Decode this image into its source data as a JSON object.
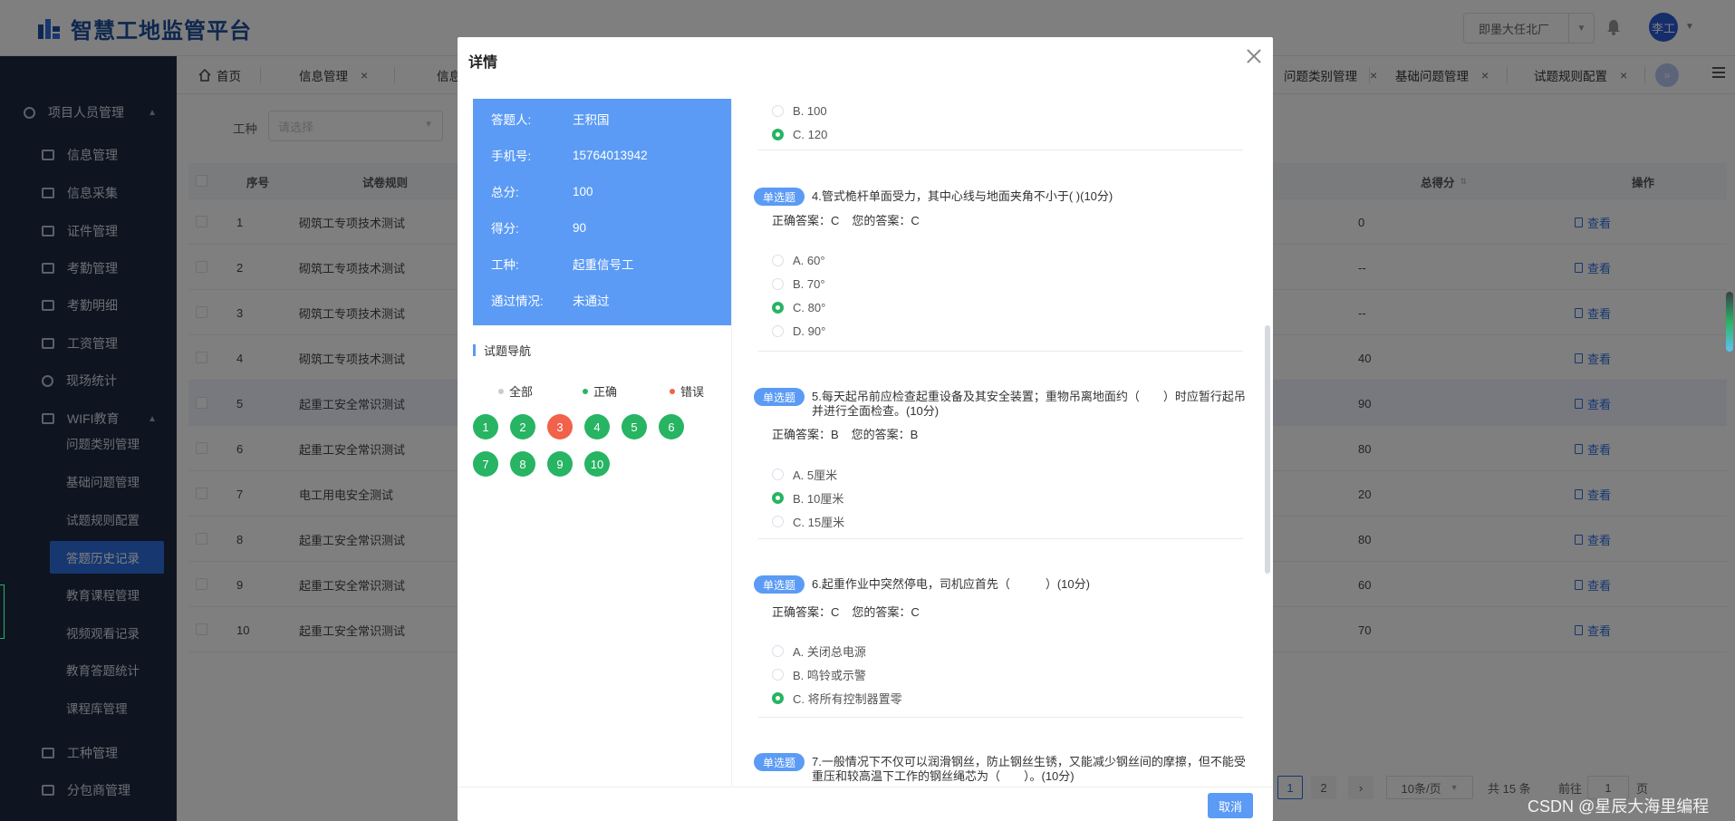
{
  "app": {
    "title": "智慧工地监管平台",
    "factory_select": "即墨大任北厂",
    "user_avatar": "李工",
    "watermark": "CSDN @星辰大海里编程"
  },
  "sidebar": {
    "groups": [
      {
        "label": "项目人员管理",
        "expanded": true
      },
      {
        "label": "WIFI教育",
        "expanded": true
      }
    ],
    "items_top": [
      "信息管理",
      "信息采集",
      "证件管理",
      "考勤管理",
      "考勤明细",
      "工资管理",
      "现场统计"
    ],
    "wifi_sub": [
      "问题类别管理",
      "基础问题管理",
      "试题规则配置",
      "答题历史记录",
      "教育课程管理",
      "视频观看记录",
      "教育答题统计",
      "课程库管理"
    ],
    "active": "答题历史记录",
    "items_bottom": [
      "工种管理",
      "分包商管理"
    ]
  },
  "tabs": {
    "home": "首页",
    "items": [
      "信息管理",
      "信息",
      "问题类别管理",
      "基础问题管理",
      "试题规则配置"
    ],
    "more_icon": "»"
  },
  "filter": {
    "label": "工种",
    "placeholder": "请选择"
  },
  "table": {
    "headers": {
      "seq": "序号",
      "rule": "试卷规则",
      "total": "总得分",
      "op": "操作"
    },
    "rows": [
      {
        "seq": "1",
        "rule": "砌筑工专项技术测试",
        "score": "0"
      },
      {
        "seq": "2",
        "rule": "砌筑工专项技术测试",
        "score": "--"
      },
      {
        "seq": "3",
        "rule": "砌筑工专项技术测试",
        "score": "--"
      },
      {
        "seq": "4",
        "rule": "砌筑工专项技术测试",
        "score": "40"
      },
      {
        "seq": "5",
        "rule": "起重工安全常识测试",
        "score": "90"
      },
      {
        "seq": "6",
        "rule": "起重工安全常识测试",
        "score": "80"
      },
      {
        "seq": "7",
        "rule": "电工用电安全测试",
        "score": "20"
      },
      {
        "seq": "8",
        "rule": "起重工安全常识测试",
        "score": "80"
      },
      {
        "seq": "9",
        "rule": "起重工安全常识测试",
        "score": "60"
      },
      {
        "seq": "10",
        "rule": "起重工安全常识测试",
        "score": "70"
      }
    ],
    "view_label": "查看"
  },
  "pagination": {
    "pages": [
      "1",
      "2"
    ],
    "current": "1",
    "next": "›",
    "size": "10条/页",
    "total": "共 15 条",
    "goto": "前往",
    "goto_value": "1",
    "page_unit": "页"
  },
  "modal": {
    "title": "详情",
    "info": [
      {
        "k": "答题人:",
        "v": "王积国"
      },
      {
        "k": "手机号:",
        "v": "15764013942"
      },
      {
        "k": "总分:",
        "v": "100"
      },
      {
        "k": "得分:",
        "v": "90"
      },
      {
        "k": "工种:",
        "v": "起重信号工"
      },
      {
        "k": "通过情况:",
        "v": "未通过"
      }
    ],
    "nav_title": "试题导航",
    "legend": {
      "all": "全部",
      "correct": "正确",
      "wrong": "错误"
    },
    "question_numbers": [
      {
        "n": "1",
        "ok": true
      },
      {
        "n": "2",
        "ok": true
      },
      {
        "n": "3",
        "ok": false
      },
      {
        "n": "4",
        "ok": true
      },
      {
        "n": "5",
        "ok": true
      },
      {
        "n": "6",
        "ok": true
      },
      {
        "n": "7",
        "ok": true
      },
      {
        "n": "8",
        "ok": true
      },
      {
        "n": "9",
        "ok": true
      },
      {
        "n": "10",
        "ok": true
      }
    ],
    "prev_options": [
      {
        "label": "B. 100",
        "selected": false
      },
      {
        "label": "C. 120",
        "selected": true
      }
    ],
    "questions": [
      {
        "tag": "单选题",
        "text": "4.管式桅杆单面受力，其中心线与地面夹角不小于( )(10分)",
        "correct": "正确答案：C",
        "mine": "您的答案：C",
        "options": [
          {
            "label": "A. 60°",
            "selected": false
          },
          {
            "label": "B. 70°",
            "selected": false
          },
          {
            "label": "C. 80°",
            "selected": true
          },
          {
            "label": "D. 90°",
            "selected": false
          }
        ]
      },
      {
        "tag": "单选题",
        "text": "5.每天起吊前应检查起重设备及其安全装置；重物吊离地面约（　　）时应暂行起吊并进行全面检查。(10分)",
        "correct": "正确答案：B",
        "mine": "您的答案：B",
        "options": [
          {
            "label": "A. 5厘米",
            "selected": false
          },
          {
            "label": "B. 10厘米",
            "selected": true
          },
          {
            "label": "C. 15厘米",
            "selected": false
          }
        ]
      },
      {
        "tag": "单选题",
        "text": "6.起重作业中突然停电，司机应首先（　　　）(10分)",
        "correct": "正确答案：C",
        "mine": "您的答案：C",
        "options": [
          {
            "label": "A. 关闭总电源",
            "selected": false
          },
          {
            "label": "B. 鸣铃或示警",
            "selected": false
          },
          {
            "label": "C. 将所有控制器置零",
            "selected": true
          }
        ]
      },
      {
        "tag": "单选题",
        "text": "7.一般情况下不仅可以润滑钢丝，防止钢丝生锈，又能减少钢丝间的摩擦，但不能受重压和较高温下工作的钢丝绳芯为（　　）。(10分)"
      }
    ],
    "cancel": "取消"
  },
  "colors": {
    "brand": "#1f4e9c",
    "accent": "#5b9bf5",
    "correct": "#27b463",
    "wrong": "#f26149",
    "sidebar": "#1d2b43"
  }
}
